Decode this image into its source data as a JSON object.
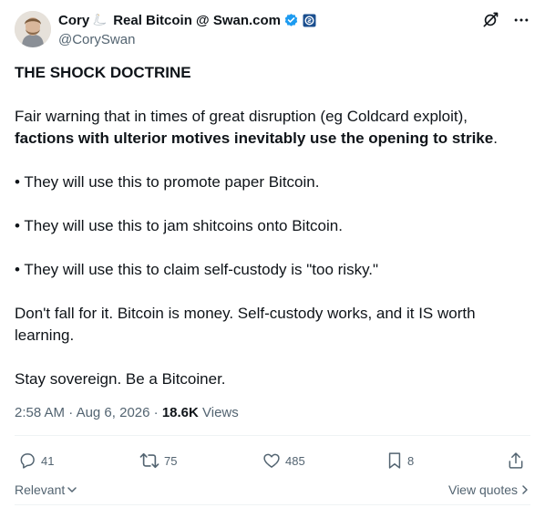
{
  "author": {
    "display_name_part1": "Cory",
    "display_name_part2": "Real Bitcoin @ Swan.com",
    "handle": "@CorySwan",
    "verified_color": "#1d9bf0",
    "org_badge_color": "#1b4f8f"
  },
  "post": {
    "title": "THE SHOCK DOCTRINE",
    "para1_plain": "Fair warning that in times of great disruption (eg Coldcard exploit),",
    "para1_bold": "factions with ulterior motives inevitably use the opening to strike",
    "para1_end": ".",
    "bullet1": "• They will use this to promote paper Bitcoin.",
    "bullet2": "• They will use this to jam shitcoins onto Bitcoin.",
    "bullet3": "• They will use this to claim self-custody is \"too risky.\"",
    "para2": "Don't fall for it.  Bitcoin is money. Self-custody works, and it IS worth learning.",
    "para3": "Stay sovereign.  Be a Bitcoiner."
  },
  "meta": {
    "time": "2:58 AM",
    "sep1": " · ",
    "date": "Aug 6, 2026",
    "sep2": " · ",
    "views_count": "18.6K",
    "views_label": " Views"
  },
  "actions": {
    "replies": "41",
    "reposts": "75",
    "likes": "485",
    "bookmarks": "8",
    "icon_names": [
      "reply-icon",
      "repost-icon",
      "like-icon",
      "bookmark-icon",
      "share-icon"
    ]
  },
  "footer": {
    "sort_label": "Relevant",
    "view_quotes": "View quotes"
  },
  "colors": {
    "text": "#0f1419",
    "secondary": "#536471",
    "divider": "#eff3f4",
    "accent": "#1d9bf0"
  }
}
